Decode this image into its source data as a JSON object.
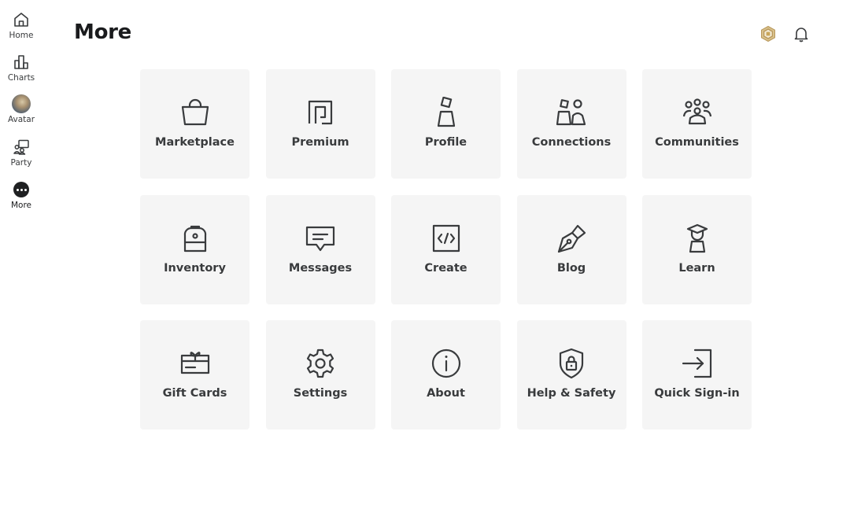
{
  "page": {
    "title": "More"
  },
  "colors": {
    "background": "#ffffff",
    "tile_background": "#f5f5f5",
    "icon_stroke": "#393b3d",
    "currency_gold": "#c9a55a"
  },
  "sidebar": {
    "items": [
      {
        "label": "Home",
        "icon": "home-icon",
        "active": false
      },
      {
        "label": "Charts",
        "icon": "charts-icon",
        "active": false
      },
      {
        "label": "Avatar",
        "icon": "avatar-icon",
        "active": false
      },
      {
        "label": "Party",
        "icon": "party-icon",
        "active": false
      },
      {
        "label": "More",
        "icon": "more-icon",
        "active": true
      }
    ]
  },
  "header": {
    "icons": [
      "robux-icon",
      "notification-bell-icon"
    ]
  },
  "tiles": [
    {
      "label": "Marketplace",
      "icon": "shopping-bag-icon"
    },
    {
      "label": "Premium",
      "icon": "premium-icon"
    },
    {
      "label": "Profile",
      "icon": "profile-icon"
    },
    {
      "label": "Connections",
      "icon": "connections-icon"
    },
    {
      "label": "Communities",
      "icon": "communities-icon"
    },
    {
      "label": "Inventory",
      "icon": "backpack-icon"
    },
    {
      "label": "Messages",
      "icon": "message-icon"
    },
    {
      "label": "Create",
      "icon": "code-icon"
    },
    {
      "label": "Blog",
      "icon": "pen-nib-icon"
    },
    {
      "label": "Learn",
      "icon": "graduation-icon"
    },
    {
      "label": "Gift Cards",
      "icon": "gift-card-icon"
    },
    {
      "label": "Settings",
      "icon": "gear-icon"
    },
    {
      "label": "About",
      "icon": "info-icon"
    },
    {
      "label": "Help & Safety",
      "icon": "shield-lock-icon"
    },
    {
      "label": "Quick Sign-in",
      "icon": "sign-in-icon"
    }
  ]
}
